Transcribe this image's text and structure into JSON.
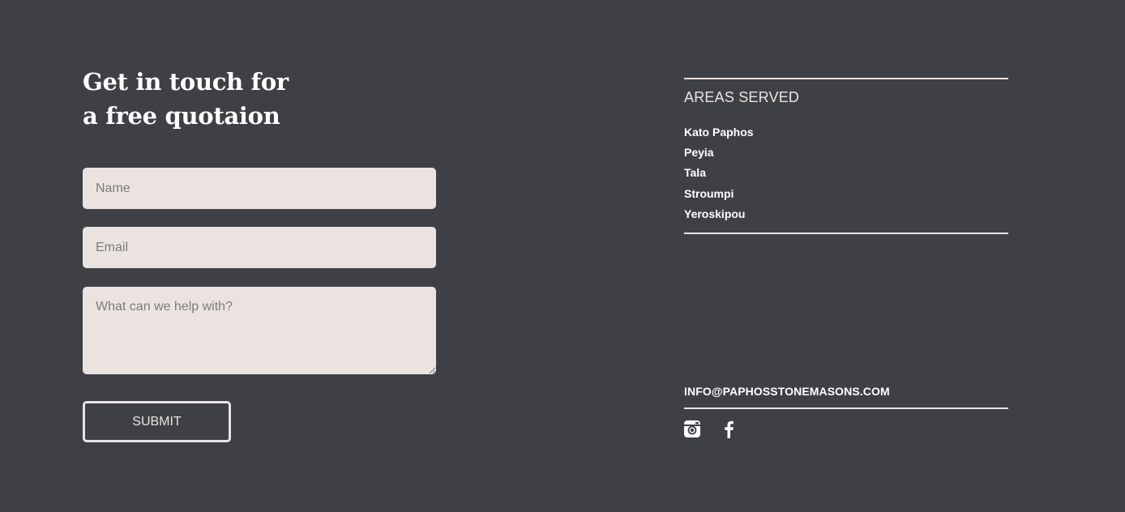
{
  "contact": {
    "heading_line1": "Get in touch for",
    "heading_line2": "a free quotaion",
    "name_placeholder": "Name",
    "email_placeholder": "Email",
    "message_placeholder": "What can we help with?",
    "submit_label": "SUBMIT"
  },
  "areas": {
    "title": "AREAS SERVED",
    "items": [
      "Kato Paphos",
      "Peyia",
      "Tala",
      "Stroumpi",
      "Yeroskipou"
    ]
  },
  "footer": {
    "email": "INFO@PAPHOSSTONEMASONS.COM",
    "social": [
      {
        "icon": "instagram-icon"
      },
      {
        "icon": "facebook-icon"
      }
    ]
  },
  "colors": {
    "background": "#3f4045",
    "field_background": "#ebe3e0",
    "text": "#ffffff",
    "accent": "#ebe3e0"
  }
}
